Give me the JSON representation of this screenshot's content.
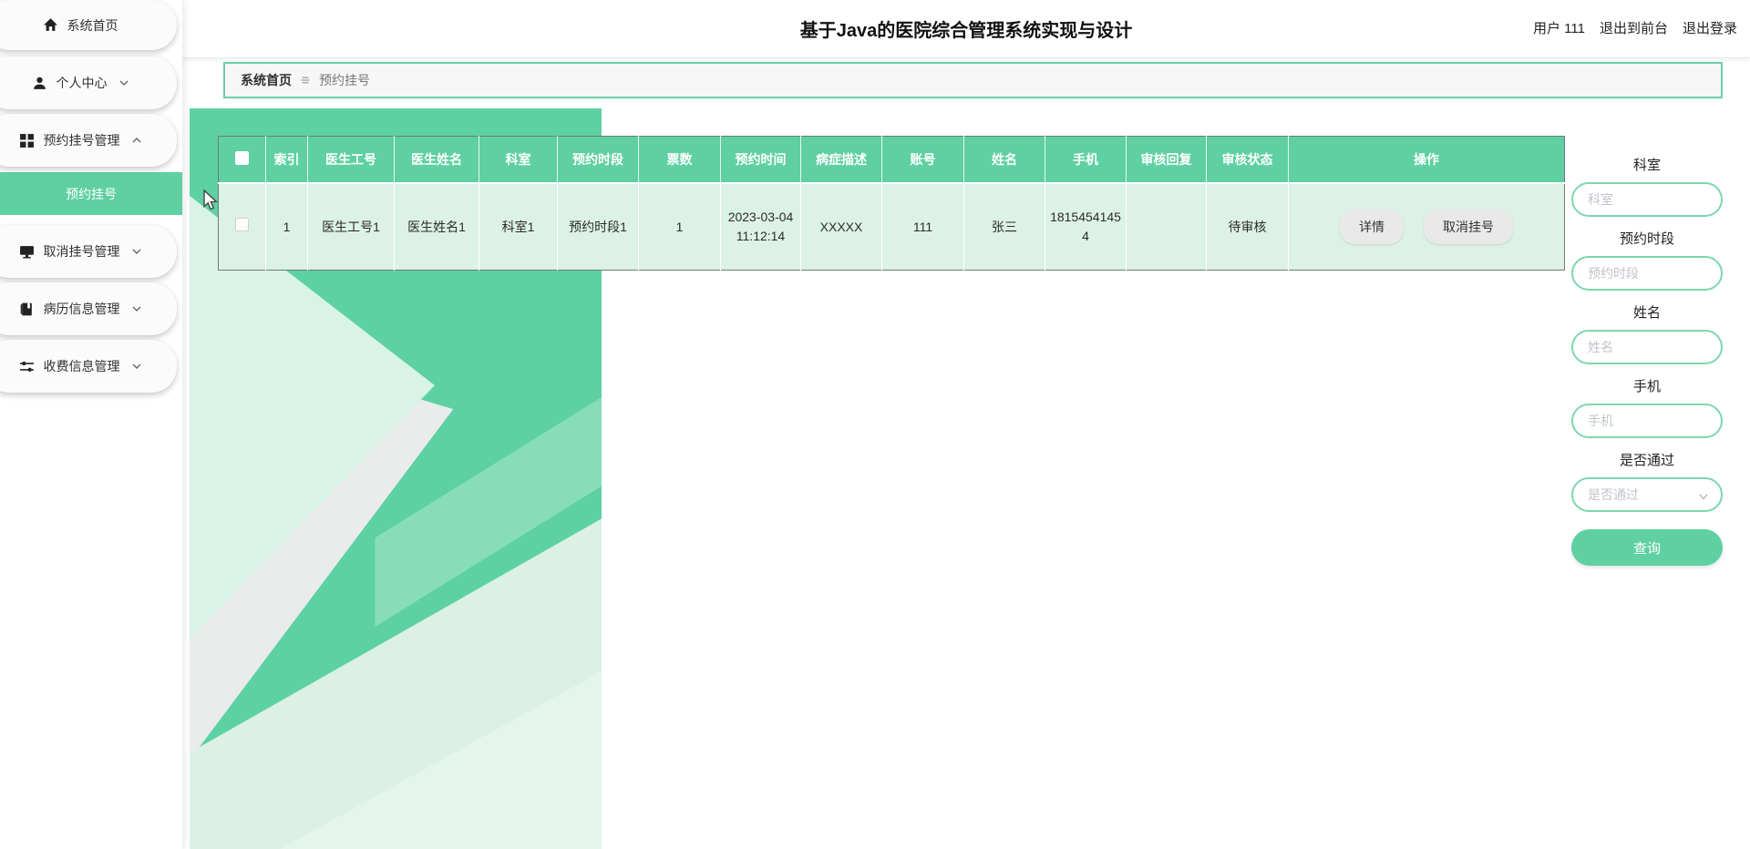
{
  "header": {
    "title": "基于Java的医院综合管理系统实现与设计",
    "user": "用户 111",
    "exit_front": "退出到前台",
    "logout": "退出登录"
  },
  "sidebar": {
    "items": [
      {
        "label": "系统首页",
        "icon": "home-icon",
        "chevron": "none"
      },
      {
        "label": "个人中心",
        "icon": "user-icon",
        "chevron": "down"
      },
      {
        "label": "预约挂号管理",
        "icon": "grid-icon",
        "chevron": "up"
      },
      {
        "label": "取消挂号管理",
        "icon": "monitor-icon",
        "chevron": "down"
      },
      {
        "label": "病历信息管理",
        "icon": "book-icon",
        "chevron": "down"
      },
      {
        "label": "收费信息管理",
        "icon": "sliders-icon",
        "chevron": "down"
      }
    ],
    "active_subitem": "预约挂号"
  },
  "breadcrumb": {
    "home": "系统首页",
    "current": "预约挂号"
  },
  "table": {
    "headers": [
      "索引",
      "医生工号",
      "医生姓名",
      "科室",
      "预约时段",
      "票数",
      "预约时间",
      "病症描述",
      "账号",
      "姓名",
      "手机",
      "审核回复",
      "审核状态",
      "操作"
    ],
    "rows": [
      {
        "index": "1",
        "doctor_id": "医生工号1",
        "doctor_name": "医生姓名1",
        "department": "科室1",
        "time_slot": "预约时段1",
        "tickets": "1",
        "appointment_time": "2023-03-04 11:12:14",
        "symptoms": "XXXXX",
        "account": "111",
        "name": "张三",
        "phone": "18154541454",
        "review_reply": "",
        "review_status": "待审核",
        "actions": [
          "详情",
          "取消挂号"
        ]
      }
    ]
  },
  "search_panel": {
    "fields": [
      {
        "label": "科室",
        "placeholder": "科室",
        "type": "input"
      },
      {
        "label": "预约时段",
        "placeholder": "预约时段",
        "type": "input"
      },
      {
        "label": "姓名",
        "placeholder": "姓名",
        "type": "input"
      },
      {
        "label": "手机",
        "placeholder": "手机",
        "type": "input"
      },
      {
        "label": "是否通过",
        "placeholder": "是否通过",
        "type": "select"
      }
    ],
    "submit_label": "查询"
  },
  "colors": {
    "accent": "#5fd0a2",
    "row_background": "#ddf2e7",
    "input_border": "#7dd7b0",
    "breadcrumb_border": "#6fcda6",
    "action_button_background": "#e9e9e9"
  }
}
